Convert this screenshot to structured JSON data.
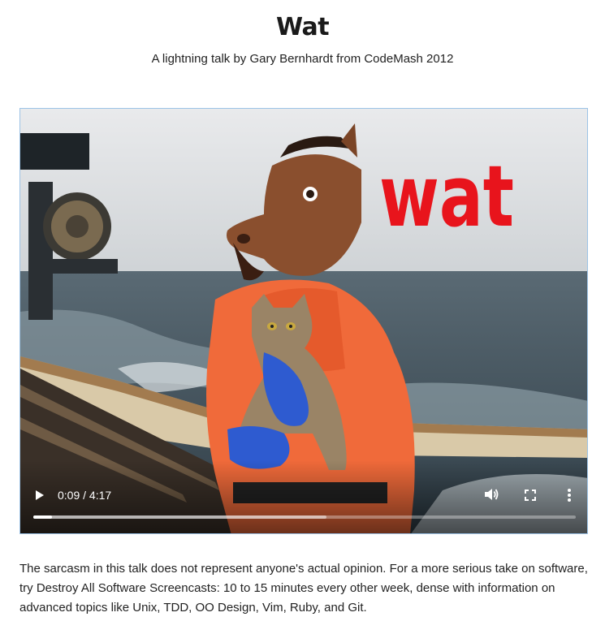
{
  "page": {
    "title": "Wat",
    "subtitle": "A lightning talk by Gary Bernhardt from CodeMash 2012"
  },
  "video": {
    "overlay_text": "wat",
    "current_time": "0:09",
    "duration": "4:17",
    "time_display": "0:09 / 4:17",
    "played_fraction": 0.035,
    "buffered_fraction": 0.54,
    "icons": {
      "play": "play-icon",
      "volume": "volume-icon",
      "fullscreen": "fullscreen-icon",
      "more": "more-options-icon"
    }
  },
  "description": {
    "text_before_link": "The sarcasm in this talk does not represent anyone's actual opinion. For a more serious take on software, try ",
    "link_text": "Destroy All Software Screencasts",
    "text_after_link": ": 10 to 15 minutes every other week, dense with information on advanced topics like Unix, TDD, OO Design, Vim, Ruby, and Git."
  },
  "colors": {
    "wat_text": "#e8141c",
    "jacket": "#f06a3a",
    "video_border": "#9cc3e6"
  }
}
